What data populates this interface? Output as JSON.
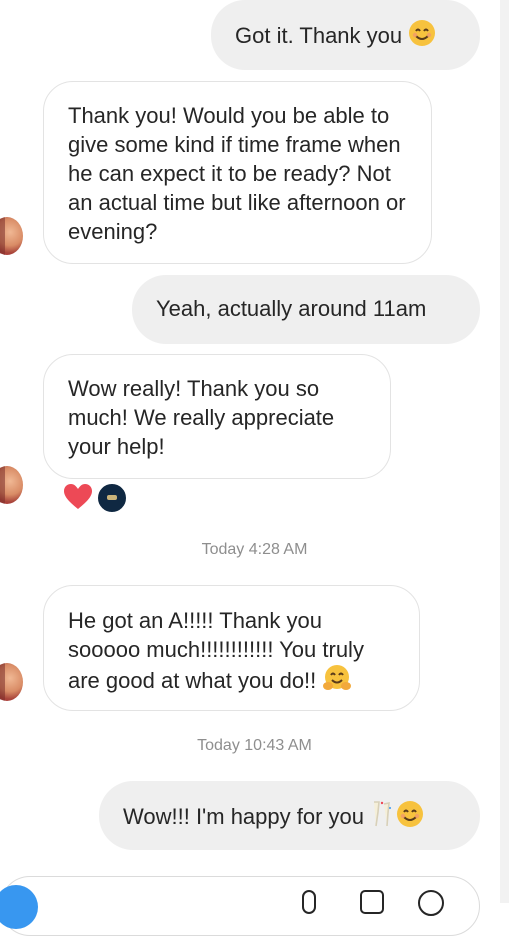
{
  "messages": [
    {
      "direction": "sent",
      "text": "Got it. Thank you",
      "emoji": "smiling-face-emoji"
    },
    {
      "direction": "received",
      "text": "Thank you! Would you be able to give some kind if time frame when he can expect it to be ready? Not an actual time but like afternoon or evening?"
    },
    {
      "direction": "sent",
      "text": "Yeah, actually around 11am"
    },
    {
      "direction": "received",
      "text": "Wow really! Thank you so much! We really appreciate your help!",
      "reactions": [
        "heart-reaction",
        "profile-reaction"
      ]
    },
    {
      "direction": "received",
      "text": "He got an A!!!!! Thank you sooooo much!!!!!!!!!!!! You truly are good at what you do!!",
      "emoji": "hugging-face-emoji"
    },
    {
      "direction": "sent",
      "text": "Wow!!! I'm happy for you",
      "emoji": [
        "champagne-emoji",
        "smiling-face-emoji"
      ]
    }
  ],
  "timestamps": [
    "Today 4:28 AM",
    "Today 10:43 AM"
  ],
  "colors": {
    "sent_bubble": "#efefef",
    "received_border": "#e3e3e3",
    "timestamp_text": "#8e8e8e",
    "heart": "#ed4956",
    "accent": "#3897f0"
  }
}
